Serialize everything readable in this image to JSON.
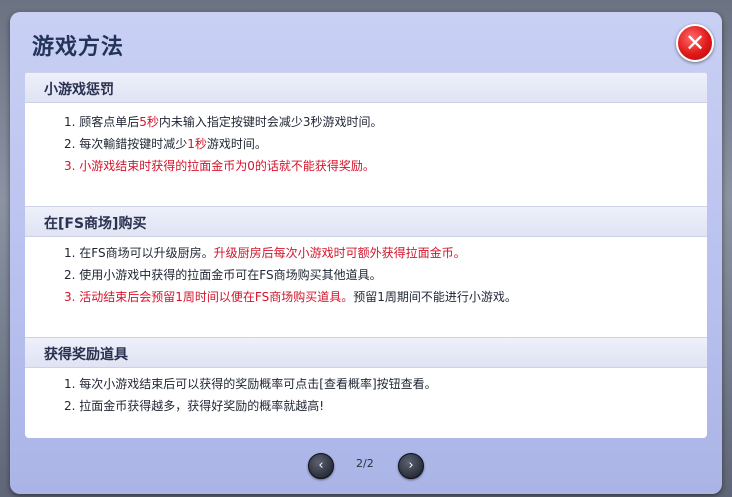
{
  "dialog": {
    "title": "游戏方法",
    "close_label": "✕"
  },
  "sections": [
    {
      "heading": "小游戏惩罚",
      "lines": [
        {
          "parts": [
            {
              "t": "1. 顾客点单后",
              "red": false
            },
            {
              "t": "5秒",
              "red": true
            },
            {
              "t": "内未输入指定按键时会减少3秒游戏时间。",
              "red": false
            }
          ]
        },
        {
          "parts": [
            {
              "t": "2. 每次輸錯按键时减少",
              "red": false
            },
            {
              "t": "1秒",
              "red": true
            },
            {
              "t": "游戏时间。",
              "red": false
            }
          ]
        },
        {
          "parts": [
            {
              "t": "3. 小游戏结束时获得的拉面金币为0的话就不能获得奖励。",
              "red": true
            }
          ]
        }
      ]
    },
    {
      "heading": "在[FS商场]购买",
      "lines": [
        {
          "parts": [
            {
              "t": "1. 在FS商场可以升级厨房。",
              "red": false
            },
            {
              "t": "升级厨房后每次小游戏时可额外获得拉面金币。",
              "red": true
            }
          ]
        },
        {
          "parts": [
            {
              "t": "2. 使用小游戏中获得的拉面金币可在FS商场购买其他道具。",
              "red": false
            }
          ]
        },
        {
          "parts": [
            {
              "t": "3. 活动结束后会预留1周时间以便在FS商场购买道具。",
              "red": true
            },
            {
              "t": "预留1周期间不能进行小游戏。",
              "red": false
            }
          ]
        }
      ]
    },
    {
      "heading": "获得奖励道具",
      "lines": [
        {
          "parts": [
            {
              "t": "1. 每次小游戏结束后可以获得的奖励概率可点击[查看概率]按钮查看。",
              "red": false
            }
          ]
        },
        {
          "parts": [
            {
              "t": "2. 拉面金币获得越多，获得好奖励的概率就越高!",
              "red": false
            }
          ]
        }
      ]
    }
  ],
  "pager": {
    "prev_icon": "‹",
    "next_icon": "›",
    "indicator": "2/2"
  },
  "colors": {
    "accent_red": "#d4142b",
    "title_color": "#24335a",
    "dialog_bg": "#c0c8f1"
  }
}
